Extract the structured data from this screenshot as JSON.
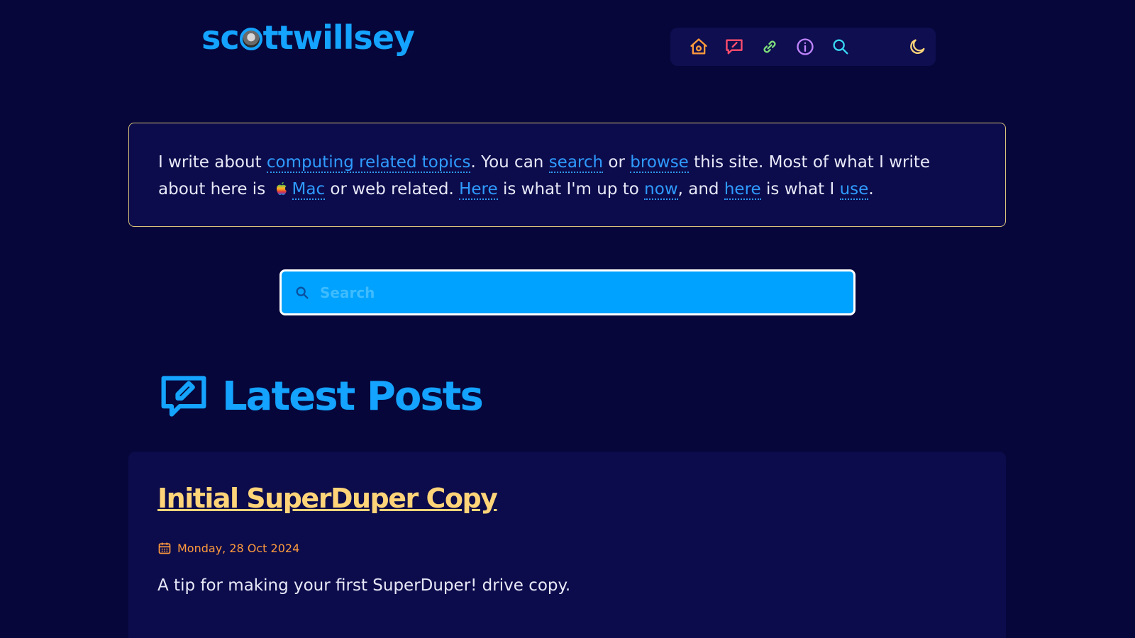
{
  "header": {
    "logo_text_start": "sc",
    "logo_text_end": "ttwillsey",
    "nav": {
      "home_icon": "home-icon",
      "posts_icon": "pencil-message-icon",
      "links_icon": "link-icon",
      "about_icon": "info-icon",
      "search_icon": "search-icon",
      "theme_icon": "moon-icon"
    }
  },
  "intro": {
    "t1": "I write about ",
    "link_topics": "computing related topics",
    "t2": ". You can ",
    "link_search": "search",
    "t3": " or ",
    "link_browse": "browse",
    "t4": " this site. Most of what I write about here is ",
    "link_mac": "Mac",
    "t5": " or web related. ",
    "link_here1": "Here",
    "t6": " is what I'm up to ",
    "link_now": "now",
    "t7": ", and ",
    "link_here2": "here",
    "t8": " is what I ",
    "link_use": "use",
    "t9": "."
  },
  "search": {
    "placeholder": "Search",
    "value": ""
  },
  "latest": {
    "title": "Latest Posts"
  },
  "posts": [
    {
      "title": "Initial SuperDuper Copy",
      "date": "Monday, 28 Oct 2024",
      "summary": "A tip for making your first SuperDuper! drive copy."
    }
  ],
  "colors": {
    "background": "#06063a",
    "card": "#0c0c4c",
    "accent_blue": "#14a3ff",
    "link": "#2f9bff",
    "post_title": "#ffd479",
    "date": "#ff9a3c",
    "intro_border": "#d8c27a"
  }
}
